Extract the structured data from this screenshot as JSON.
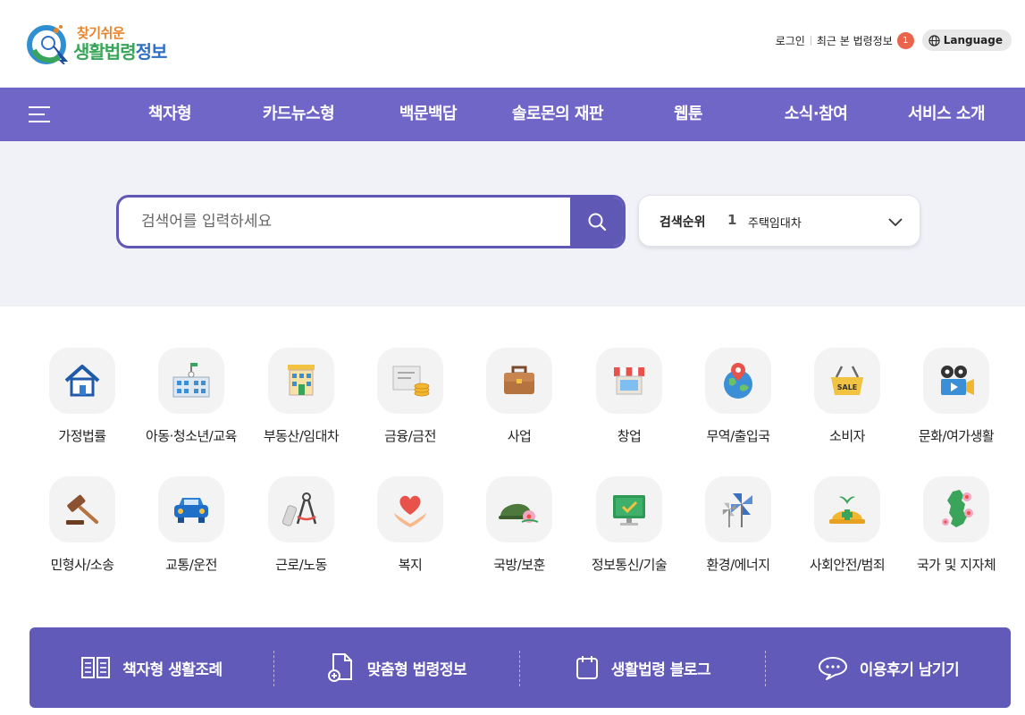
{
  "header": {
    "logo_sub": "찾기쉬운",
    "logo_main_1": "생활법령",
    "logo_main_2": "정보",
    "login": "로그인",
    "recent": "최근 본 법령정보",
    "recent_count": "1",
    "language": "Language"
  },
  "nav": {
    "menu_icon": "hamburger-icon",
    "items": [
      "책자형",
      "카드뉴스형",
      "백문백답",
      "솔로몬의 재판",
      "웹툰",
      "소식·참여",
      "서비스 소개"
    ]
  },
  "search": {
    "placeholder": "검색어를 입력하세요",
    "value": "",
    "rank_label": "검색순위",
    "rank_number": "1",
    "rank_term": "주택임대차"
  },
  "categories": [
    {
      "label": "가정법률",
      "icon": "house-icon"
    },
    {
      "label": "아동·청소년/교육",
      "icon": "school-icon"
    },
    {
      "label": "부동산/임대차",
      "icon": "building-icon"
    },
    {
      "label": "금융/금전",
      "icon": "money-icon"
    },
    {
      "label": "사업",
      "icon": "briefcase-icon"
    },
    {
      "label": "창업",
      "icon": "storefront-icon"
    },
    {
      "label": "무역/출입국",
      "icon": "globe-icon"
    },
    {
      "label": "소비자",
      "icon": "shopping-basket-icon"
    },
    {
      "label": "문화/여가생활",
      "icon": "movie-camera-icon"
    },
    {
      "label": "민형사/소송",
      "icon": "gavel-icon"
    },
    {
      "label": "교통/운전",
      "icon": "car-icon"
    },
    {
      "label": "근로/노동",
      "icon": "drafting-tools-icon"
    },
    {
      "label": "복지",
      "icon": "heart-hands-icon"
    },
    {
      "label": "국방/보훈",
      "icon": "helmet-flower-icon"
    },
    {
      "label": "정보통신/기술",
      "icon": "monitor-check-icon"
    },
    {
      "label": "환경/에너지",
      "icon": "pinwheel-icon"
    },
    {
      "label": "사회안전/범죄",
      "icon": "safety-helmet-icon"
    },
    {
      "label": "국가 및 지자체",
      "icon": "korea-map-icon"
    }
  ],
  "quick_links": [
    {
      "label": "책자형 생활조례",
      "icon": "book-icon"
    },
    {
      "label": "맞춤형 법령정보",
      "icon": "document-plus-icon"
    },
    {
      "label": "생활법령 블로그",
      "icon": "notepad-icon"
    },
    {
      "label": "이용후기 남기기",
      "icon": "chat-bubble-icon"
    }
  ],
  "colors": {
    "brand_purple": "#7066c8",
    "dark_purple": "#5f58b4",
    "badge": "#e8644a"
  }
}
